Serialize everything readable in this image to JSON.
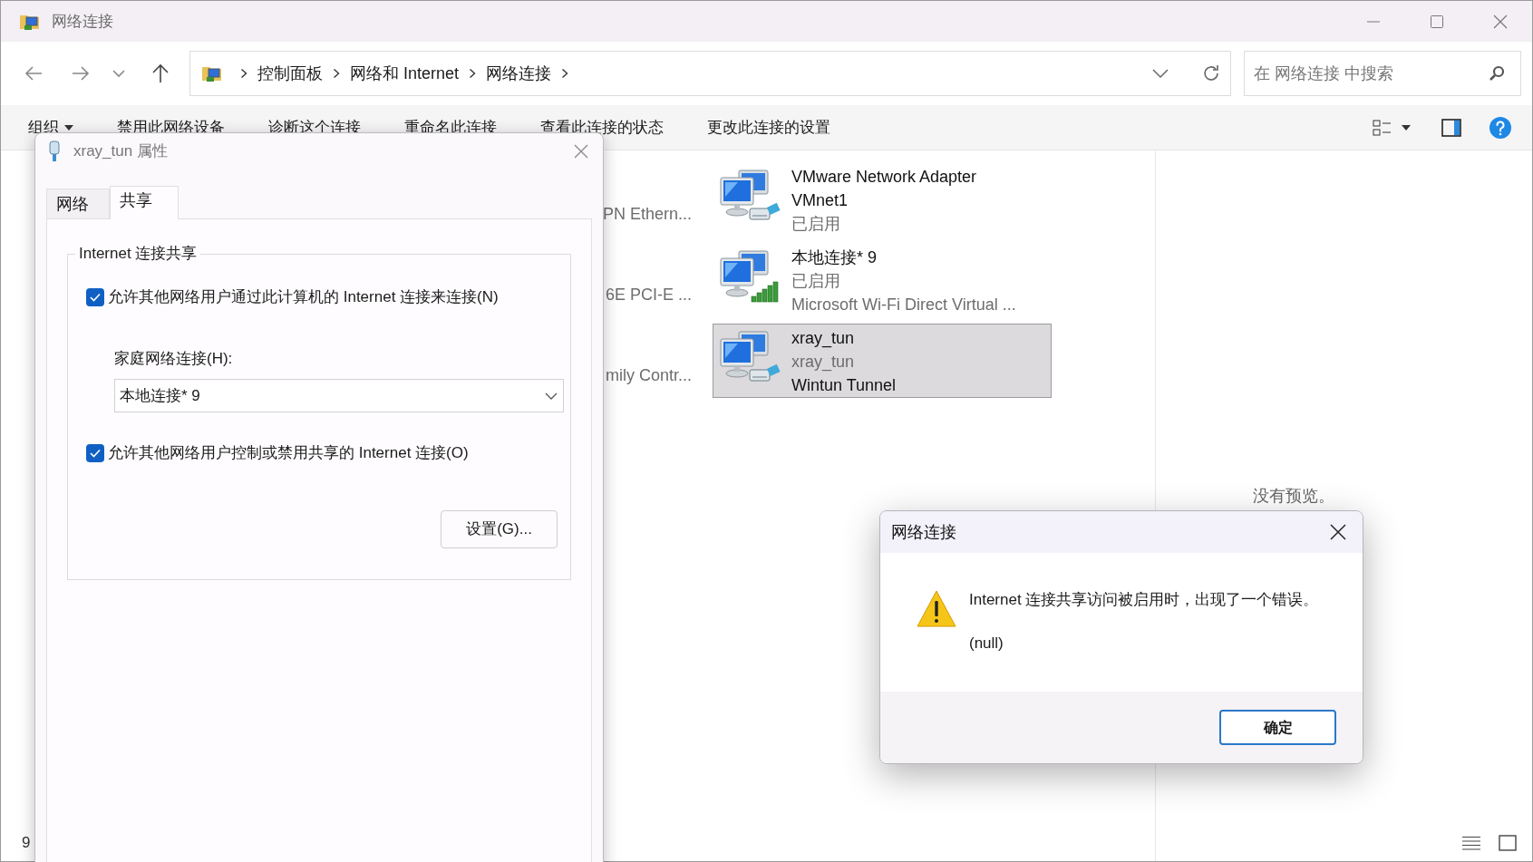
{
  "window": {
    "title": "网络连接"
  },
  "navigation": {
    "breadcrumb": [
      "控制面板",
      "网络和 Internet",
      "网络连接"
    ],
    "search": {
      "placeholder": "在 网络连接 中搜索"
    }
  },
  "command_bar": {
    "items": [
      {
        "label": "组织",
        "kind": "menu"
      },
      {
        "label": "禁用此网络设备",
        "kind": "command"
      },
      {
        "label": "诊断这个连接",
        "kind": "command"
      },
      {
        "label": "重命名此连接",
        "kind": "command"
      },
      {
        "label": "查看此连接的状态",
        "kind": "command"
      },
      {
        "label": "更改此连接的设置",
        "kind": "command"
      }
    ]
  },
  "hidden_connections": [
    {
      "description": "PN Ethern..."
    },
    {
      "description": "6E PCI-E ..."
    },
    {
      "description": "mily Contr..."
    }
  ],
  "connections": [
    {
      "name": "VMware Network Adapter VMnet1",
      "status": "已启用",
      "kind": "wired",
      "selected": false
    },
    {
      "name": "本地连接* 9",
      "status": "已启用",
      "description": "Microsoft Wi-Fi Direct Virtual ...",
      "kind": "wireless",
      "selected": false
    },
    {
      "name": "xray_tun",
      "status": "xray_tun",
      "description": "Wintun Tunnel",
      "kind": "wired",
      "selected": true
    }
  ],
  "preview": {
    "text": "没有预览。"
  },
  "status_bar": {
    "item_count": "9"
  },
  "properties_dialog": {
    "title": "xray_tun 属性",
    "tabs": [
      {
        "label": "网络",
        "selected": false
      },
      {
        "label": "共享",
        "selected": true
      }
    ],
    "group_title": "Internet 连接共享",
    "allow_connect": {
      "label": "允许其他网络用户通过此计算机的 Internet 连接来连接(N)",
      "checked": true
    },
    "home_network_label": "家庭网络连接(H):",
    "home_network": {
      "value": "本地连接* 9"
    },
    "allow_control": {
      "label": "允许其他网络用户控制或禁用共享的 Internet 连接(O)",
      "checked": true
    },
    "settings_button": "设置(G)..."
  },
  "message_box": {
    "title": "网络连接",
    "message": "Internet 连接共享访问被启用时，出现了一个错误。",
    "detail": "(null)",
    "buttons": [
      "确定"
    ]
  }
}
